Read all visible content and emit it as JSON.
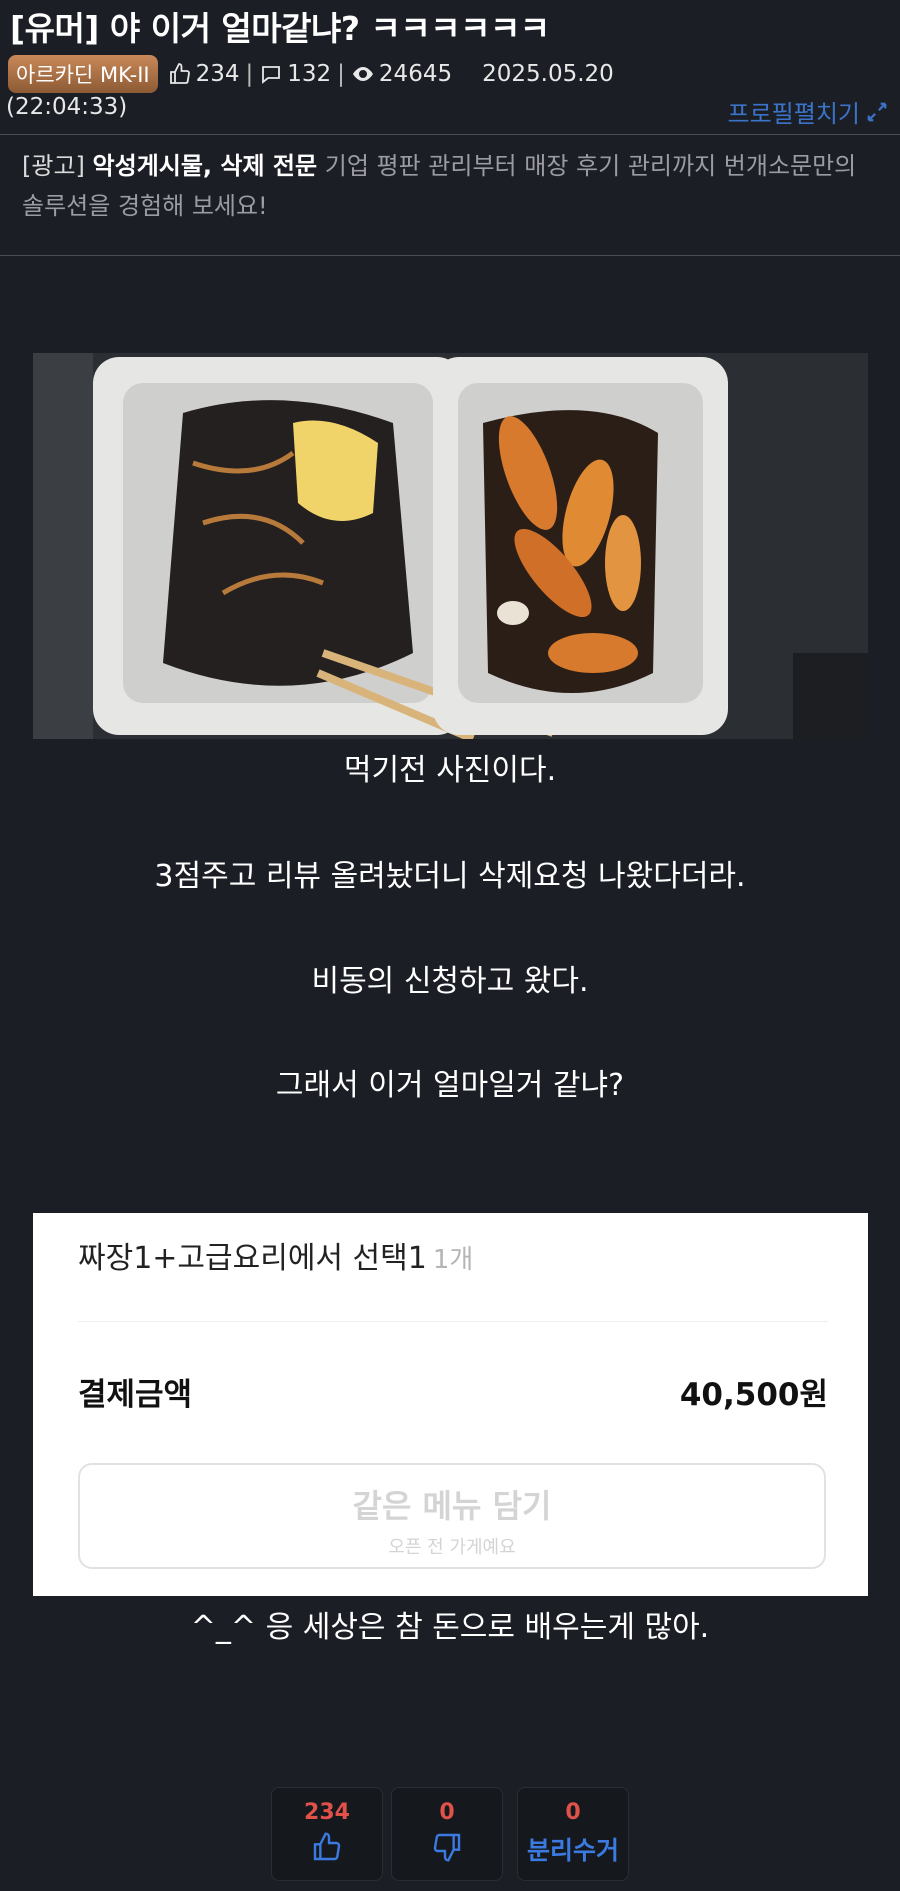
{
  "post": {
    "title": "[유머] 야 이거 얼마같냐? ㅋㅋㅋㅋㅋㅋ",
    "author": "아르카딘 MK-II",
    "likes": "234",
    "comments": "132",
    "views": "24645",
    "date": "2025.05.20",
    "time": "(22:04:33)",
    "profile_toggle": "프로필펼치기"
  },
  "ad": {
    "tag": "[광고]",
    "headline": "악성게시물, 삭제 전문",
    "text": "기업 평판 관리부터 매장 후기 관리까지 번개소문만의 솔루션을 경험해 보세요!"
  },
  "content": {
    "line1": "먹기전 사진이다.",
    "line2": "3점주고 리뷰 올려놨더니 삭제요청 나왔다더라.",
    "line3": "비동의 신청하고 왔다.",
    "line4": "그래서 이거 얼마일거 같냐?",
    "line5": "^_^ 응 세상은 참 돈으로 배우는게 많아."
  },
  "receipt": {
    "item": "짜장1+고급요리에서 선택1",
    "qty": "1개",
    "total_label": "결제금액",
    "total_value": "40,500원",
    "button_label": "같은 메뉴 담기",
    "button_sub": "오픈 전 가게예요"
  },
  "votes": {
    "up_count": "234",
    "down_count": "0",
    "recycle_count": "0",
    "recycle_label": "분리수거"
  },
  "colors": {
    "background": "#1b1e24",
    "link": "#3b73c8",
    "vote_count": "#e0514a",
    "vote_icon": "#3b7ae0"
  }
}
